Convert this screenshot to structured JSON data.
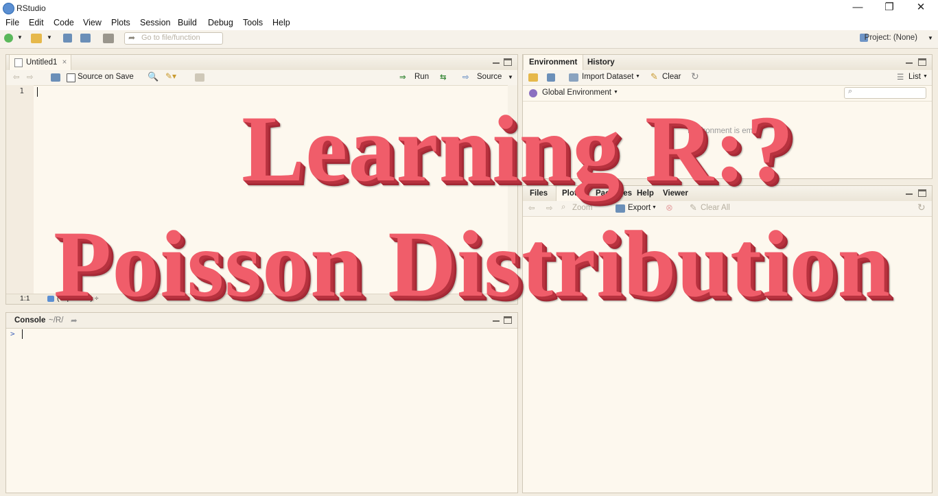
{
  "window": {
    "title": "RStudio",
    "min_glyph": "—",
    "restore_glyph": "❐",
    "close_glyph": "✕"
  },
  "menu": [
    "File",
    "Edit",
    "Code",
    "View",
    "Plots",
    "Session",
    "Build",
    "Debug",
    "Tools",
    "Help"
  ],
  "toolbar": {
    "goto_placeholder": "Go to file/function",
    "project_label": "Project: (None)"
  },
  "editor": {
    "tab_label": "Untitled1",
    "source_on_save": "Source on Save",
    "run_label": "Run",
    "source_label": "Source",
    "line_number": "1",
    "cursor_pos": "1:1",
    "file_type": "(Top Level) ÷"
  },
  "console": {
    "tab_label": "Console",
    "path": "~/R/",
    "prompt": ">"
  },
  "environment": {
    "tabs": [
      "Environment",
      "History"
    ],
    "import_label": "Import Dataset",
    "clear_label": "Clear",
    "list_label": "List",
    "scope_label": "Global Environment",
    "empty_text": "Environment is empty"
  },
  "files": {
    "tabs": [
      "Files",
      "Plots",
      "Packages",
      "Help",
      "Viewer"
    ],
    "zoom_label": "Zoom",
    "export_label": "Export",
    "clear_all_label": "Clear All"
  },
  "overlay": {
    "line1": "Learning R:?",
    "line2": "Poisson Distribution"
  },
  "colors": {
    "overlay_text": "#f05d6a",
    "pane_bg": "#fdf8ee",
    "chrome_bg": "#f3ede1"
  }
}
